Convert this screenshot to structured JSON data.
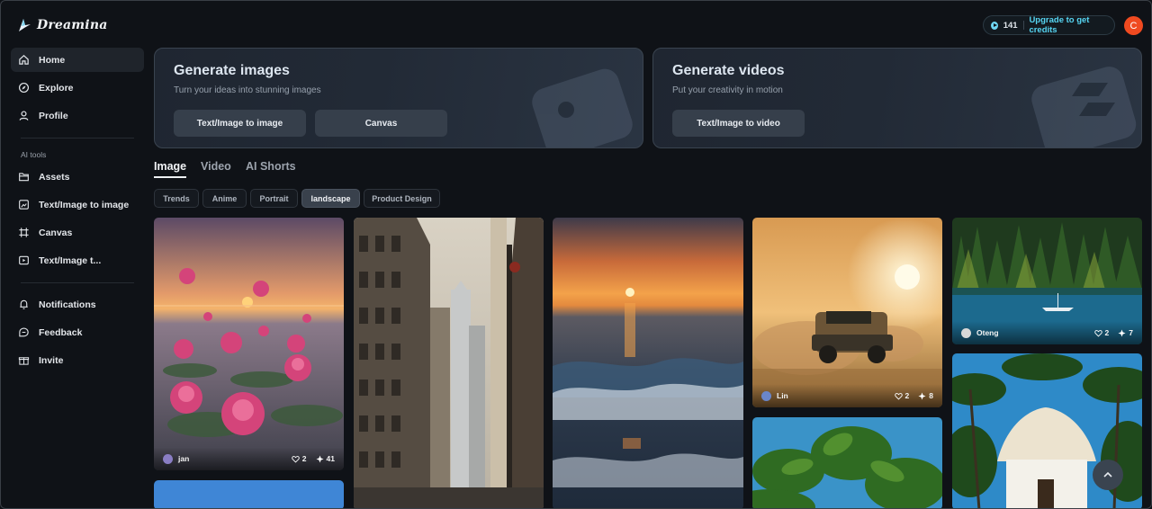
{
  "app": {
    "name": "Dreamina",
    "credits": "141",
    "upgrade_label": "Upgrade to get credits",
    "avatar_initial": "C"
  },
  "sidebar": {
    "items": [
      {
        "label": "Home",
        "icon": "home-icon",
        "active": true
      },
      {
        "label": "Explore",
        "icon": "compass-icon"
      },
      {
        "label": "Profile",
        "icon": "user-icon"
      }
    ],
    "section_label": "AI tools",
    "tools": [
      {
        "label": "Assets",
        "icon": "folder-icon"
      },
      {
        "label": "Text/Image to image",
        "icon": "image-generate-icon"
      },
      {
        "label": "Canvas",
        "icon": "canvas-icon"
      },
      {
        "label": "Text/Image t...",
        "icon": "video-generate-icon"
      }
    ],
    "bottom": [
      {
        "label": "Notifications",
        "icon": "bell-icon"
      },
      {
        "label": "Feedback",
        "icon": "feedback-icon"
      },
      {
        "label": "Invite",
        "icon": "gift-icon"
      }
    ]
  },
  "hero": {
    "images": {
      "title": "Generate images",
      "subtitle": "Turn your ideas into stunning images",
      "buttons": [
        "Text/Image to image",
        "Canvas"
      ]
    },
    "videos": {
      "title": "Generate videos",
      "subtitle": "Put your creativity in motion",
      "buttons": [
        "Text/Image to video"
      ]
    }
  },
  "tabs": [
    "Image",
    "Video",
    "AI Shorts"
  ],
  "active_tab": "Image",
  "chips": [
    "Trends",
    "Anime",
    "Portrait",
    "landscape",
    "Product Design"
  ],
  "active_chip": "landscape",
  "gallery": [
    {
      "subject": "pink roses on water at sunset",
      "author": "jan",
      "likes": "2",
      "remixes": "41"
    },
    {
      "subject": "city street with tall buildings"
    },
    {
      "subject": "ocean sunset waves"
    },
    {
      "subject": "off-road truck in desert dust at sunset",
      "author": "Lin",
      "likes": "2",
      "remixes": "8"
    },
    {
      "subject": "forest lake with sailboat",
      "author": "Oteng",
      "likes": "2",
      "remixes": "7"
    },
    {
      "subject": "blue sky"
    },
    {
      "subject": "tropical leaves against blue sky"
    },
    {
      "subject": "thatched hut among palm trees"
    }
  ],
  "colors": {
    "background": "#0f1217",
    "accent": "#56d5f2",
    "avatar": "#f04a20"
  }
}
